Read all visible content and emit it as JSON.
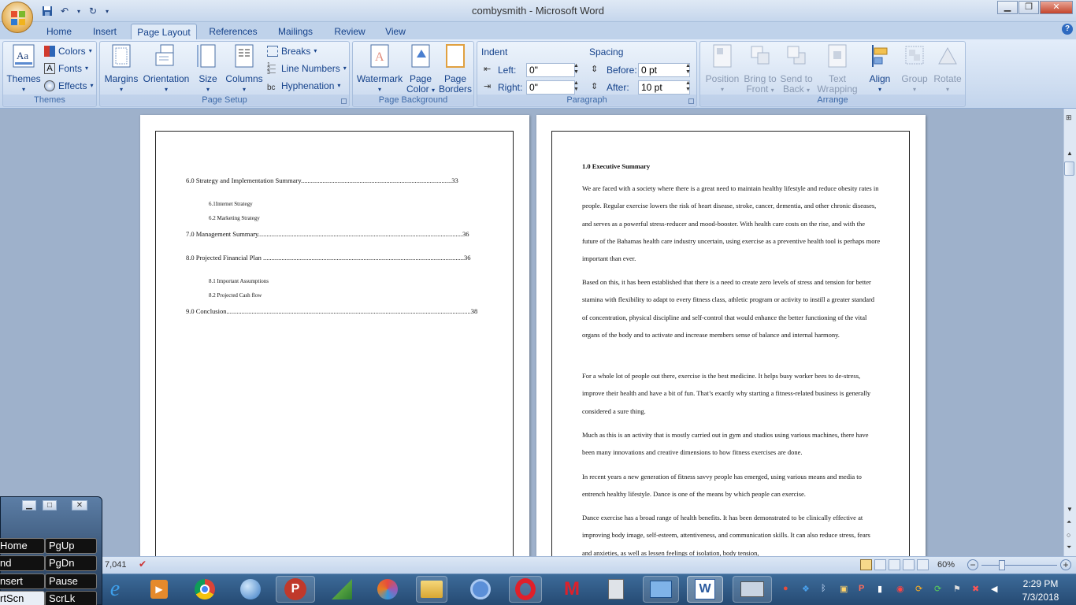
{
  "window": {
    "title": "combysmith - Microsoft Word"
  },
  "qat": {
    "save_icon": "save-icon",
    "undo_icon": "undo-icon",
    "redo_icon": "redo-icon"
  },
  "tabs": [
    "Home",
    "Insert",
    "Page Layout",
    "References",
    "Mailings",
    "Review",
    "View"
  ],
  "active_tab": "Page Layout",
  "ribbon": {
    "themes": {
      "big_label": "Themes",
      "colors": "Colors",
      "fonts": "Fonts",
      "effects": "Effects",
      "group": "Themes"
    },
    "page_setup": {
      "margins": "Margins",
      "orientation": "Orientation",
      "size": "Size",
      "columns": "Columns",
      "breaks": "Breaks",
      "line_numbers": "Line Numbers",
      "hyphenation": "Hyphenation",
      "group": "Page Setup"
    },
    "page_background": {
      "watermark": "Watermark",
      "page_color_1": "Page",
      "page_color_2": "Color",
      "page_borders_1": "Page",
      "page_borders_2": "Borders",
      "group": "Page Background"
    },
    "paragraph": {
      "indent_label": "Indent",
      "left_label": "Left:",
      "left_value": "0\"",
      "right_label": "Right:",
      "right_value": "0\"",
      "spacing_label": "Spacing",
      "before_label": "Before:",
      "before_value": "0 pt",
      "after_label": "After:",
      "after_value": "10 pt",
      "group": "Paragraph"
    },
    "arrange": {
      "position": "Position",
      "bring_1": "Bring to",
      "bring_2": "Front",
      "send_1": "Send to",
      "send_2": "Back",
      "wrap_1": "Text",
      "wrap_2": "Wrapping",
      "align": "Align",
      "grp": "Group",
      "rotate": "Rotate",
      "group": "Arrange"
    }
  },
  "page1": {
    "toc": [
      {
        "text": "6.0   Strategy and Implementation Summary..........................................................................................33",
        "size": "big"
      },
      {
        "text": "6.1Internet Strategy",
        "size": "small"
      },
      {
        "text": "6.2 Marketing Strategy",
        "size": "small"
      },
      {
        "text": "7.0   Management Summary..........................................................................................................................36",
        "size": "big"
      },
      {
        "text": "8.0 Projected Financial Plan ........................................................................................................................36",
        "size": "big"
      },
      {
        "text": "8.1 Important Assumptions",
        "size": "small"
      },
      {
        "text": "8.2 Projected Cash flow",
        "size": "small"
      },
      {
        "text": "9.0 Conclusion..................................................................................................................................................38",
        "size": "big"
      }
    ]
  },
  "page2": {
    "heading": "1.0 Executive Summary",
    "paragraphs": [
      "We are faced with a society where there is a great need to maintain healthy lifestyle and reduce obesity rates in people. Regular exercise lowers the risk of heart disease, stroke, cancer, dementia, and other chronic diseases, and serves as a powerful stress-reducer and mood-booster. With health care costs on the rise, and with the future of the Bahamas health care  industry uncertain, using exercise as a preventive health tool is perhaps more important than ever.",
      "Based on this, it has been established that there is a need to create zero levels of stress and tension for better stamina with flexibility to adapt to every fitness class, athletic program or activity to instill a greater standard of concentration, physical discipline and self-control that would enhance the better functioning of the vital organs of the body and to activate and increase members sense of balance and  internal harmony.",
      "For a whole lot of people out there, exercise is the best medicine. It helps busy worker bees to de-stress, improve their health and have a bit of fun. That’s exactly why starting a fitness-related business is generally considered a sure thing.",
      " Much as this is an activity that is mostly carried out in gym and studios using various machines, there have been many innovations and creative dimensions to how fitness exercises are done.",
      "In recent years  a new generation of fitness savvy people has emerged, using various means and media to entrench healthy lifestyle. Dance is one of the means by which people can exercise.",
      "Dance exercise has a broad range of health benefits. It has been demonstrated to be clinically effective at improving body image, self-esteem, attentiveness, and communication skills. It can also reduce stress, fears and anxieties, as well as lessen feelings of isolation, body tension,"
    ]
  },
  "statusbar": {
    "words": "7,041",
    "zoom": "60%"
  },
  "osk": {
    "keys": [
      "Home",
      "PgUp",
      "nd",
      "PgDn",
      "nsert",
      "Pause",
      "rtScn",
      "ScrLk"
    ]
  },
  "clock": {
    "time": "2:29 PM",
    "date": "7/3/2018"
  },
  "colors": {
    "accent": "#15428b",
    "ribbon": "#cddcf0",
    "taskbar": "#254a73"
  }
}
